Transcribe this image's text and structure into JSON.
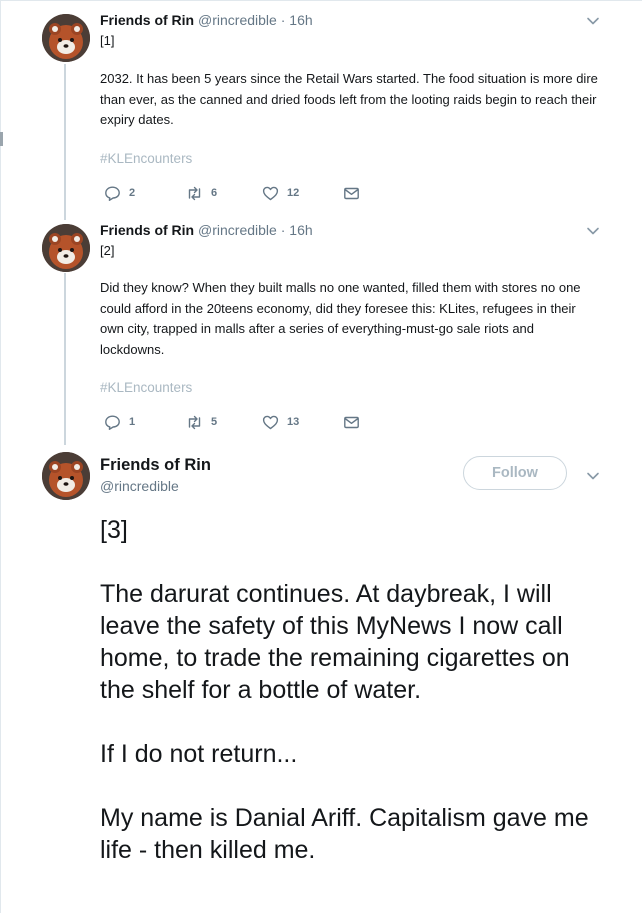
{
  "tweets": [
    {
      "author_name": "Friends of Rin",
      "handle": "@rincredible",
      "separator": "·",
      "time": "16h",
      "index_label": "[1]",
      "body": "2032. It has been 5 years since the Retail Wars started. The food situation is more dire than ever, as the canned and dried foods left from the looting raids begin to reach their expiry dates.",
      "hashtag": "#KLEncounters",
      "replies": "2",
      "retweets": "6",
      "likes": "12"
    },
    {
      "author_name": "Friends of Rin",
      "handle": "@rincredible",
      "separator": "·",
      "time": "16h",
      "index_label": "[2]",
      "body": "Did they know? When they built malls no one wanted, filled them with stores no one could afford in the 20teens economy, did they foresee this: KLites, refugees in their own city, trapped in malls after a series of everything-must-go sale riots and lockdowns.",
      "hashtag": "#KLEncounters",
      "replies": "1",
      "retweets": "5",
      "likes": "13"
    }
  ],
  "main_tweet": {
    "author_name": "Friends of Rin",
    "handle": "@rincredible",
    "follow_label": "Follow",
    "paragraphs": [
      "[3]",
      "The darurat continues. At daybreak, I will leave the safety of this MyNews I now call home, to trade the remaining cigarettes on the shelf for a bottle of water.",
      "If I do not return...",
      "My name is Danial Ariff. Capitalism gave me life - then killed me."
    ]
  },
  "icons": {
    "reply": "reply-icon",
    "retweet": "retweet-icon",
    "like": "heart-icon",
    "message": "envelope-icon",
    "caret": "chevron-down-icon"
  },
  "colors": {
    "text": "#14171a",
    "secondary": "#657786",
    "hashtag": "#aab8c2",
    "thread_line": "#ccd6dd"
  }
}
